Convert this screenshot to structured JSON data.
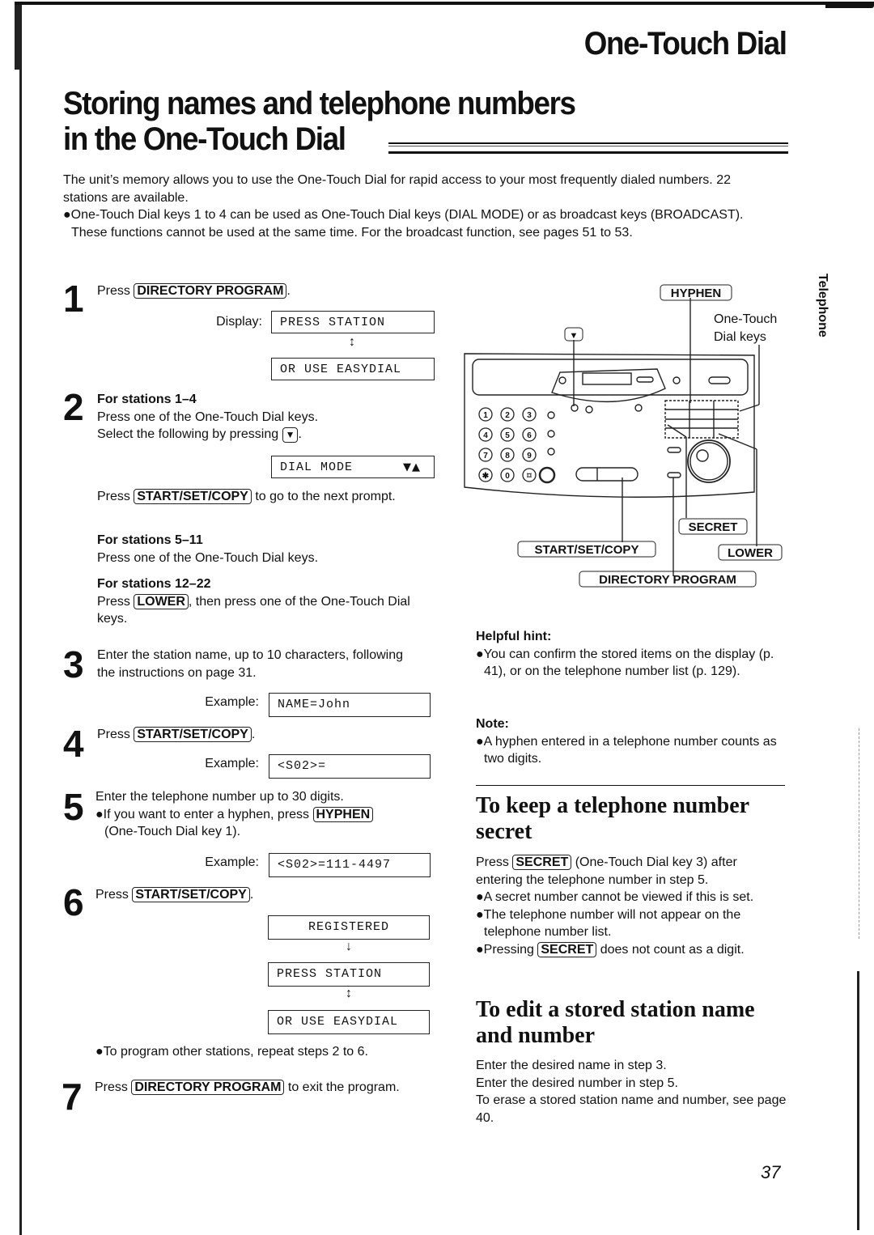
{
  "header": {
    "section_title": "One-Touch Dial",
    "main_title_line1": "Storing names and telephone numbers",
    "main_title_line2": "in the One-Touch Dial"
  },
  "intro": {
    "paragraph": "The unit’s memory allows you to use the One-Touch Dial for rapid access to your most frequently dialed numbers. 22 stations are available.",
    "bullet": "●One-Touch Dial keys 1 to 4 can be used as One-Touch Dial keys (DIAL MODE) or as broadcast keys (BROADCAST). These functions cannot be used at the same time. For the broadcast function, see pages 51 to 53."
  },
  "steps": {
    "s1": {
      "num": "1",
      "press": "Press",
      "key": "DIRECTORY PROGRAM",
      "after": ".",
      "display_label": "Display:",
      "lcd1": "PRESS STATION",
      "arrow": "↕",
      "lcd2": "OR USE EASYDIAL"
    },
    "s2": {
      "num": "2",
      "heading_a": "For stations 1–4",
      "line_a1": "Press one of the One-Touch Dial keys.",
      "line_a2": "Select the following by pressing",
      "down_key": "▼",
      "line_a2_end": ".",
      "lcd": "DIAL MODE",
      "lcd_arrows": "▼▲",
      "press": "Press",
      "key_start": "START/SET/COPY",
      "next_prompt": "to go to the next prompt.",
      "heading_b": "For stations 5–11",
      "line_b": "Press one of the One-Touch Dial keys.",
      "heading_c": "For stations 12–22",
      "key_lower": "LOWER",
      "line_c": ", then press one of the One-Touch Dial keys."
    },
    "s3": {
      "num": "3",
      "text": "Enter the station name, up to 10 characters, following the instructions on page 31.",
      "example_label": "Example:",
      "lcd": "NAME=John"
    },
    "s4": {
      "num": "4",
      "press": "Press",
      "key": "START/SET/COPY",
      "after": ".",
      "example_label": "Example:",
      "lcd": "<S02>="
    },
    "s5": {
      "num": "5",
      "text": "Enter the telephone number up to 30 digits.",
      "bullet": "●If you want to enter a hyphen, press",
      "key": "HYPHEN",
      "bullet_end": "(One-Touch Dial key 1).",
      "example_label": "Example:",
      "lcd": "<S02>=111-4497"
    },
    "s6": {
      "num": "6",
      "press": "Press",
      "key": "START/SET/COPY",
      "after": ".",
      "lcd1": "REGISTERED",
      "arrow1": "↓",
      "lcd2": "PRESS STATION",
      "arrow2": "↕",
      "lcd3": "OR USE EASYDIAL",
      "bullet": "●To program other stations, repeat steps 2 to 6."
    },
    "s7": {
      "num": "7",
      "press": "Press",
      "key": "DIRECTORY PROGRAM",
      "after": "to exit the program."
    }
  },
  "diagram": {
    "labels": {
      "hyphen": "HYPHEN",
      "one_touch_line1": "One-Touch",
      "one_touch_line2": "Dial keys",
      "down_key": "▼",
      "secret": "SECRET",
      "start_set_copy": "START/SET/COPY",
      "lower": "LOWER",
      "directory_program": "DIRECTORY PROGRAM"
    },
    "keypad": [
      "1",
      "2",
      "3",
      "4",
      "5",
      "6",
      "7",
      "8",
      "9",
      "✱",
      "0",
      "⌑"
    ]
  },
  "right_col": {
    "hint_title": "Helpful hint:",
    "hint_text": "●You can confirm the stored items on the display (p. 41), or on the telephone number list (p. 129).",
    "note_title": "Note:",
    "note_text": "●A hyphen entered in a telephone number counts as two digits.",
    "secret_heading": "To keep a telephone number secret",
    "secret_press": "Press",
    "secret_key": "SECRET",
    "secret_line": "(One-Touch Dial key 3) after entering the telephone number in step 5.",
    "secret_b1": "●A secret number cannot be viewed if this is set.",
    "secret_b2": "●The telephone number will not appear on the telephone number list.",
    "secret_b3_pre": "●Pressing",
    "secret_b3_key": "SECRET",
    "secret_b3_post": "does not count as a digit.",
    "edit_heading": "To edit a stored station name and number",
    "edit_l1": "Enter the desired name in step 3.",
    "edit_l2": "Enter the desired number in step 5.",
    "edit_l3": "To erase a stored station name and number, see page 40."
  },
  "side_tab": "Telephone",
  "page_number": "37"
}
